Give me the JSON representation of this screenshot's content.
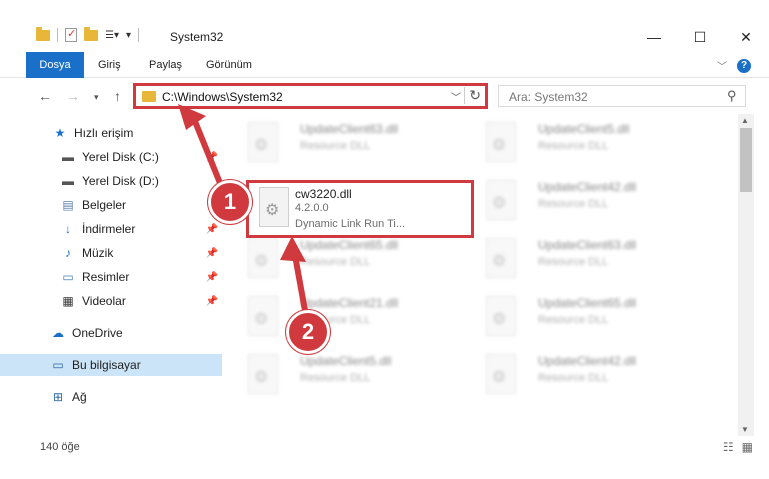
{
  "window": {
    "title": "System32",
    "controls": [
      "—",
      "☐",
      "✕"
    ]
  },
  "ribbon": {
    "tabs": [
      "Dosya",
      "Giriş",
      "Paylaş",
      "Görünüm"
    ]
  },
  "address": {
    "path": "C:\\Windows\\System32",
    "search_placeholder": "Ara: System32"
  },
  "sidebar": {
    "items": [
      {
        "label": "Hızlı erişim",
        "icon": "star-icon"
      },
      {
        "label": "Yerel Disk (C:)",
        "icon": "drive-icon"
      },
      {
        "label": "Yerel Disk (D:)",
        "icon": "drive-icon"
      },
      {
        "label": "Belgeler",
        "icon": "document-icon"
      },
      {
        "label": "İndirmeler",
        "icon": "download-icon"
      },
      {
        "label": "Müzik",
        "icon": "music-icon"
      },
      {
        "label": "Resimler",
        "icon": "pictures-icon"
      },
      {
        "label": "Videolar",
        "icon": "video-icon"
      },
      {
        "label": "OneDrive",
        "icon": "cloud-icon"
      },
      {
        "label": "Bu bilgisayar",
        "icon": "computer-icon"
      },
      {
        "label": "Ağ",
        "icon": "network-icon"
      }
    ]
  },
  "files": {
    "highlighted": {
      "name": "cw3220.dll",
      "version": "4.2.0.0",
      "description": "Dynamic Link Run Ti..."
    },
    "blurred": [
      {
        "name": "UpdateClient63.dll",
        "description": "Resource DLL"
      },
      {
        "name": "UpdateClient5.dll",
        "description": "Resource DLL"
      },
      {
        "name": "UpdateClient42.dll",
        "description": "Resource DLL"
      },
      {
        "name": "UpdateClient65.dll",
        "description": "Resource DLL"
      },
      {
        "name": "UpdateClient63.dll",
        "description": "Resource DLL"
      },
      {
        "name": "UpdateClient21.dll",
        "description": "Resource DLL"
      },
      {
        "name": "UpdateClient65.dll",
        "description": "Resource DLL"
      },
      {
        "name": "UpdateClient5.dll",
        "description": "Resource DLL"
      },
      {
        "name": "UpdateClient42.dll",
        "description": "Resource DLL"
      }
    ]
  },
  "status": {
    "count": "140 öğe"
  },
  "annotations": {
    "step1": "1",
    "step2": "2",
    "color": "#d0393d"
  }
}
